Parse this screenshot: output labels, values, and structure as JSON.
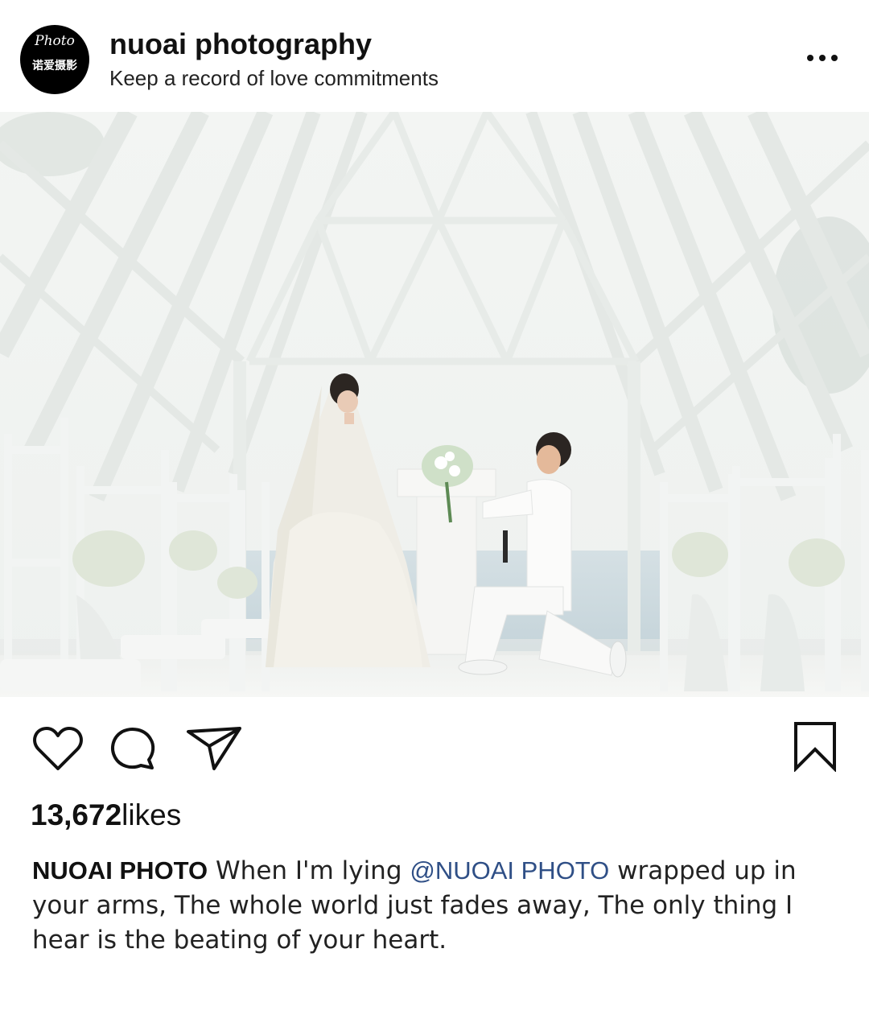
{
  "account": {
    "avatar_script": "Photo",
    "avatar_text": "诺爱摄影",
    "name": "nuoai photography",
    "tagline": "Keep a record of love commitments"
  },
  "icons": {
    "more": "more-horizontal-icon",
    "like": "heart-outline-icon",
    "comment": "comment-bubble-icon",
    "share": "paper-plane-icon",
    "save": "bookmark-outline-icon"
  },
  "post": {
    "likes_count": "13,672",
    "likes_label": "likes",
    "caption_author": "NUOAI PHOTO",
    "caption_part1": " When I'm lying ",
    "caption_mention": "@NUOAI PHOTO",
    "caption_part2": " wrapped up in your arms,  The whole world just fades away,  The only thing I hear is the beating of your heart."
  },
  "colors": {
    "text": "#111111",
    "mention": "#2f4f86",
    "avatar_bg": "#000000"
  }
}
